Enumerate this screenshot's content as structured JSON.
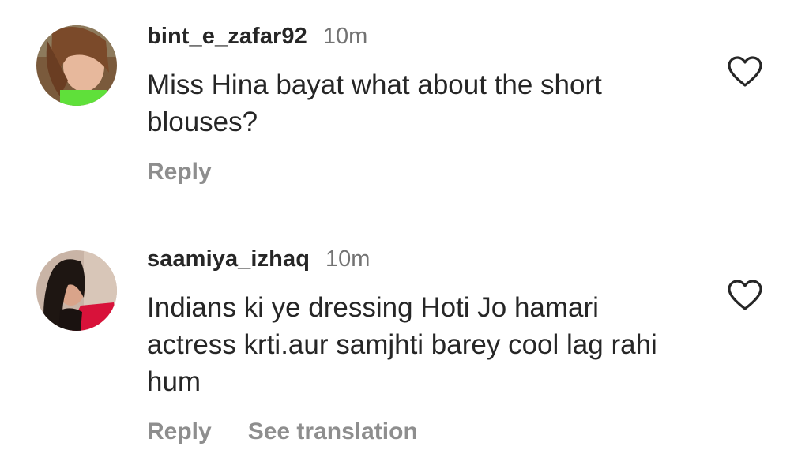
{
  "comments": [
    {
      "username": "bint_e_zafar92",
      "time": "10m",
      "text": "Miss Hina bayat what about the short blouses?",
      "actions": {
        "reply": "Reply"
      },
      "avatar_icon": "user-avatar-photo",
      "like_icon": "heart-outline-icon"
    },
    {
      "username": "saamiya_izhaq",
      "time": "10m",
      "text": "Indians ki ye dressing Hoti Jo hamari actress krti.aur samjhti barey cool lag rahi hum",
      "actions": {
        "reply": "Reply",
        "see_translation": "See translation"
      },
      "avatar_icon": "user-avatar-photo",
      "like_icon": "heart-outline-icon"
    }
  ],
  "colors": {
    "primary_text": "#262626",
    "secondary_text": "#737373",
    "action_text": "#8e8e8e",
    "background": "#ffffff"
  }
}
